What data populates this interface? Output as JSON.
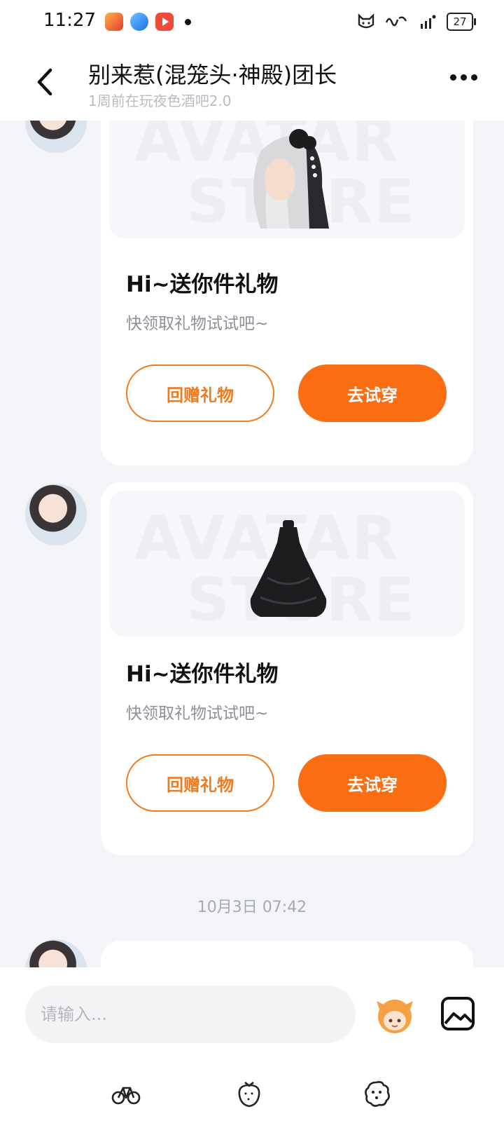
{
  "status_bar": {
    "time": "11:27",
    "battery": "27",
    "app_icons": [
      "app-icon-red",
      "app-icon-blue",
      "app-icon-video"
    ],
    "right_icons": [
      "cat-icon",
      "glyph-icon",
      "signal-icon",
      "battery-icon"
    ]
  },
  "header": {
    "title": "别来惹(混笼头·神殿)团长",
    "subtitle": "1周前在玩夜色酒吧2.0"
  },
  "messages": [
    {
      "title": "Hi~送你件礼物",
      "subtitle": "快领取礼物试试吧~",
      "watermark_top": "AVATAR",
      "watermark_bottom": "STORE",
      "item_icon": "hair-accessory-icon",
      "return_gift_label": "回赠礼物",
      "try_on_label": "去试穿"
    },
    {
      "title": "Hi~送你件礼物",
      "subtitle": "快领取礼物试试吧~",
      "watermark_top": "AVATAR",
      "watermark_bottom": "STORE",
      "item_icon": "dress-icon",
      "return_gift_label": "回赠礼物",
      "try_on_label": "去试穿"
    }
  ],
  "timestamp": "10月3日 07:42",
  "input": {
    "placeholder": "请输入..."
  },
  "bottom_tools": [
    "bicycle-icon",
    "strawberry-icon",
    "cookie-icon"
  ],
  "colors": {
    "accent": "#fb6d13",
    "accent_outline": "#f07a1e",
    "background": "#f3f4f8"
  }
}
